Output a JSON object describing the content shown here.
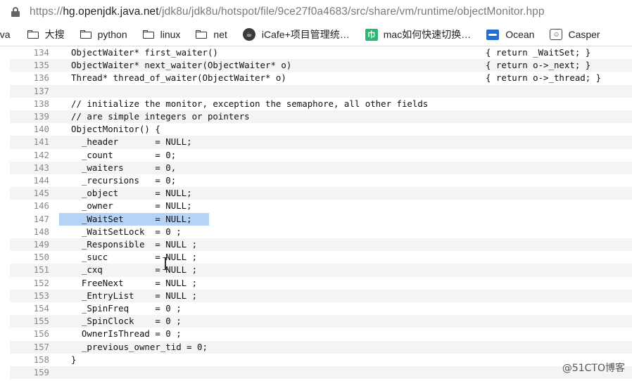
{
  "browser": {
    "url_prefix": "https://",
    "url_host": "hg.openjdk.java.net",
    "url_path": "/jdk8u/jdk8u/hotspot/file/9ce27f0a4683/src/share/vm/runtime/objectMonitor.hpp"
  },
  "bookmarks": [
    {
      "label": "ava",
      "icon": "none"
    },
    {
      "label": "大搜",
      "icon": "folder-icon"
    },
    {
      "label": "python",
      "icon": "folder-icon"
    },
    {
      "label": "linux",
      "icon": "folder-icon"
    },
    {
      "label": "net",
      "icon": "folder-icon"
    },
    {
      "label": "iCafe+项目管理统…",
      "icon": "icafe-icon"
    },
    {
      "label": "mac如何快速切换…",
      "icon": "green-m-icon"
    },
    {
      "label": "Ocean",
      "icon": "ocean-icon"
    },
    {
      "label": "Casper",
      "icon": "casper-icon"
    }
  ],
  "code": {
    "lines": [
      {
        "n": "134",
        "text": "ObjectWaiter* first_waiter()",
        "right": "{ return _WaitSet; }"
      },
      {
        "n": "135",
        "text": "ObjectWaiter* next_waiter(ObjectWaiter* o)",
        "right": "{ return o->_next; }"
      },
      {
        "n": "136",
        "text": "Thread* thread_of_waiter(ObjectWaiter* o)",
        "right": "{ return o->_thread; }"
      },
      {
        "n": "137",
        "text": "",
        "right": ""
      },
      {
        "n": "138",
        "text": "// initialize the monitor, exception the semaphore, all other fields",
        "right": ""
      },
      {
        "n": "139",
        "text": "// are simple integers or pointers",
        "right": ""
      },
      {
        "n": "140",
        "text": "ObjectMonitor() {",
        "right": ""
      },
      {
        "n": "141",
        "text": "  _header       = NULL;",
        "right": ""
      },
      {
        "n": "142",
        "text": "  _count        = 0;",
        "right": ""
      },
      {
        "n": "143",
        "text": "  _waiters      = 0,",
        "right": ""
      },
      {
        "n": "144",
        "text": "  _recursions   = 0;",
        "right": ""
      },
      {
        "n": "145",
        "text": "  _object       = NULL;",
        "right": ""
      },
      {
        "n": "146",
        "text": "  _owner        = NULL;",
        "right": ""
      },
      {
        "n": "147",
        "text": "  _WaitSet      = NULL;",
        "right": ""
      },
      {
        "n": "148",
        "text": "  _WaitSetLock  = 0 ;",
        "right": ""
      },
      {
        "n": "149",
        "text": "  _Responsible  = NULL ;",
        "right": ""
      },
      {
        "n": "150",
        "text": "  _succ         = NULL ;",
        "right": ""
      },
      {
        "n": "151",
        "text": "  _cxq          = NULL ;",
        "right": ""
      },
      {
        "n": "152",
        "text": "  FreeNext      = NULL ;",
        "right": ""
      },
      {
        "n": "153",
        "text": "  _EntryList    = NULL ;",
        "right": ""
      },
      {
        "n": "154",
        "text": "  _SpinFreq     = 0 ;",
        "right": ""
      },
      {
        "n": "155",
        "text": "  _SpinClock    = 0 ;",
        "right": ""
      },
      {
        "n": "156",
        "text": "  OwnerIsThread = 0 ;",
        "right": ""
      },
      {
        "n": "157",
        "text": "  _previous_owner_tid = 0;",
        "right": ""
      },
      {
        "n": "158",
        "text": "}",
        "right": ""
      },
      {
        "n": "159",
        "text": "",
        "right": ""
      }
    ],
    "selected_line": "147"
  },
  "watermark": "@51CTO博客"
}
